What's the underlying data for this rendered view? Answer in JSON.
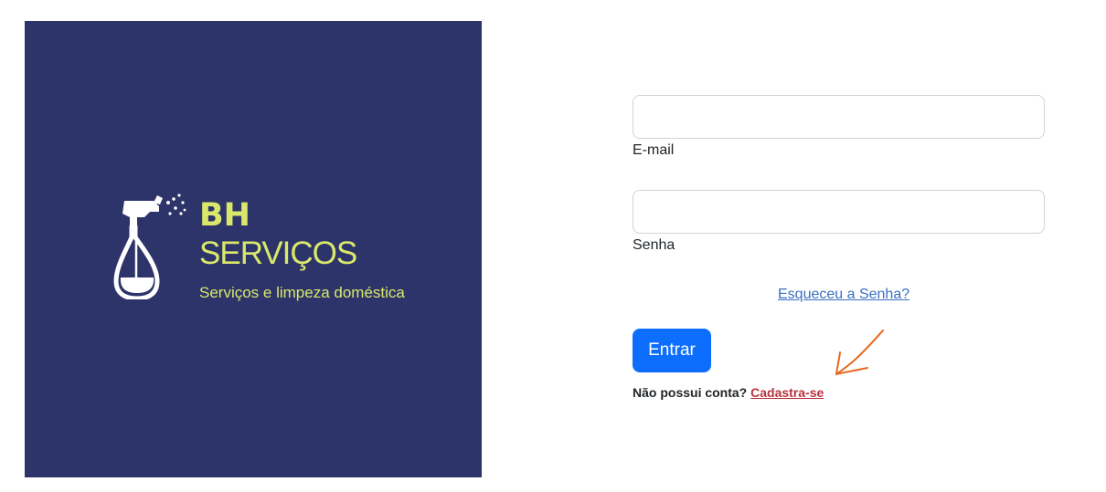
{
  "brand": {
    "title_line1": "BH",
    "title_line2": "SERVIÇOS",
    "tagline": "Serviços e limpeza doméstica",
    "logo_icon": "spray-bottle-icon",
    "background_color": "#2d346a",
    "accent_color": "#d9e86a"
  },
  "login_form": {
    "email": {
      "label": "E-mail",
      "value": "",
      "placeholder": ""
    },
    "password": {
      "label": "Senha",
      "value": "",
      "placeholder": ""
    },
    "forgot_password_link": "Esqueceu a Senha?",
    "submit_button": "Entrar",
    "signup_prompt": "Não possui conta?",
    "signup_link": "Cadastra-se",
    "primary_color": "#0d6efd",
    "signup_link_color": "#b8323f"
  },
  "annotation": {
    "icon": "arrow-annotation-icon",
    "color": "#e8661e"
  }
}
